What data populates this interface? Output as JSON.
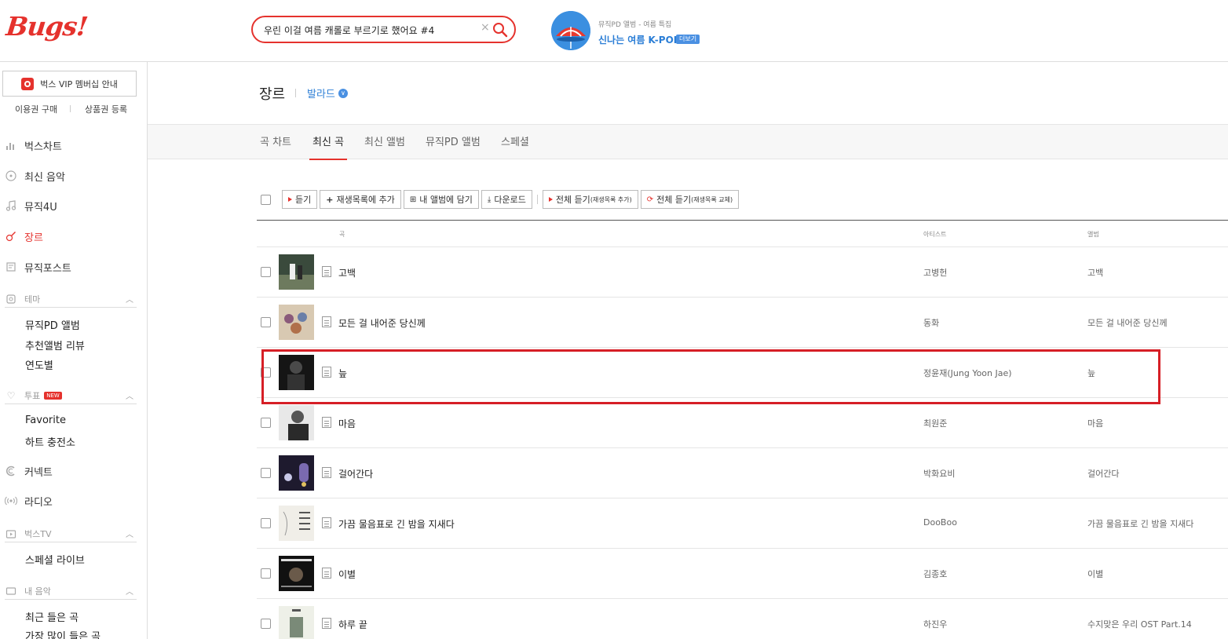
{
  "app": {
    "logo": "Bugs!"
  },
  "search": {
    "query": "우린 이걸 여름 캐롤로 부르기로 했어요 #4",
    "clear": "×"
  },
  "promo": {
    "subtitle": "뮤직PD 앨범 - 여름 특집",
    "title": "신나는 여름 K-POP",
    "more": "더보기"
  },
  "sidebar": {
    "vip": "벅스 VIP 멤버십 안내",
    "buy": "이용권 구매",
    "coupon": "상품권 등록",
    "nav": [
      {
        "label": "벅스차트"
      },
      {
        "label": "최신 음악"
      },
      {
        "label": "뮤직4U"
      },
      {
        "label": "장르"
      },
      {
        "label": "뮤직포스트"
      }
    ],
    "theme": {
      "label": "테마",
      "items": [
        "뮤직PD 앨범",
        "추천앨범 리뷰",
        "연도별"
      ]
    },
    "vote": {
      "label": "투표",
      "badge": "NEW",
      "items": [
        "Favorite",
        "하트 충전소"
      ]
    },
    "connect": "커넥트",
    "radio": "라디오",
    "bugstv": {
      "label": "벅스TV",
      "items": [
        "스페셜 라이브"
      ]
    },
    "mymusic": {
      "label": "내 음악",
      "items": [
        "최근 들은 곡",
        "가장 많이 들은 곡"
      ]
    }
  },
  "main": {
    "title": "장르",
    "genre": "발라드",
    "tabs": [
      "곡 차트",
      "최신 곡",
      "최신 앨범",
      "뮤직PD 앨범",
      "스페셜"
    ],
    "toolbar": {
      "play": "듣기",
      "add_playlist": "재생목록에 추가",
      "add_album": "내 앨범에 담기",
      "download": "다운로드",
      "play_all_add": "전체 듣기",
      "play_all_add_note": "(재생목록 추가)",
      "play_all_replace": "전체 듣기",
      "play_all_replace_note": "(재생목록 교체)"
    },
    "columns": {
      "song": "곡",
      "artist": "아티스트",
      "album": "앨범"
    },
    "rows": [
      {
        "title": "고백",
        "artist": "고병헌",
        "album": "고백"
      },
      {
        "title": "모든 걸 내어준 당신께",
        "artist": "동화",
        "album": "모든 걸 내어준 당신께"
      },
      {
        "title": "늪",
        "artist": "정윤재(Jung Yoon Jae)",
        "album": "늪"
      },
      {
        "title": "마음",
        "artist": "최원준",
        "album": "마음"
      },
      {
        "title": "걸어간다",
        "artist": "박화요비",
        "album": "걸어간다"
      },
      {
        "title": "가끔 물음표로 긴 밤을 지새다",
        "artist": "DooBoo",
        "album": "가끔 물음표로 긴 밤을 지새다"
      },
      {
        "title": "이별",
        "artist": "김종호",
        "album": "이별"
      },
      {
        "title": "하루 끝",
        "artist": "하진우",
        "album": "수지맞은 우리 OST Part.14"
      }
    ]
  },
  "colors": {
    "brand": "#e5322d",
    "link": "#2b7ed6",
    "highlight": "#d61f26"
  }
}
